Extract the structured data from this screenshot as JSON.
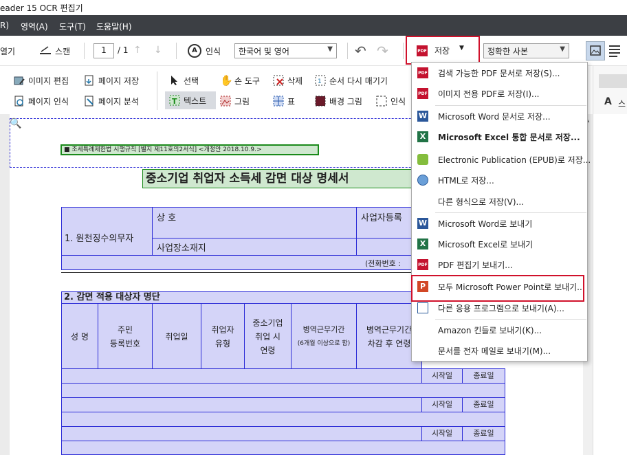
{
  "window": {
    "title": "eader 15 OCR 편집기"
  },
  "menu": {
    "items": [
      "R)",
      "영역(A)",
      "도구(T)",
      "도움말(H)"
    ]
  },
  "toolbar": {
    "open_label": "열기",
    "scan_label": "스캔",
    "page_current": "1",
    "page_total": "/ 1",
    "recognize_label": "인식",
    "language": "한국어 및 영어",
    "save_label": "저장",
    "copy_mode": "정확한 사본"
  },
  "toolbar2": {
    "image_edit": "이미지 편집",
    "page_save": "페이지 저장",
    "page_recognize": "페이지 인식",
    "page_analyze": "페이지 분석",
    "select": "선택",
    "hand_tool": "손 도구",
    "delete": "삭제",
    "reorder": "순서 다시 매기기",
    "text": "텍스트",
    "picture": "그림",
    "table": "표",
    "background": "배경 그림",
    "recognize": "인식",
    "right_partial": "스"
  },
  "save_menu": {
    "items": [
      {
        "label": "검색 가능한 PDF 문서로 저장(S)...",
        "icon": "pdf-icon"
      },
      {
        "label": "이미지 전용 PDF로 저장(I)...",
        "icon": "pdf-icon"
      },
      {
        "label": "Microsoft Word 문서로 저장...",
        "icon": "word-icon"
      },
      {
        "label": "Microsoft Excel 통합 문서로 저장...",
        "icon": "excel-icon",
        "bold": true
      },
      {
        "label": "Electronic Publication (EPUB)로 저장...",
        "icon": "epub-icon"
      },
      {
        "label": "HTML로 저장...",
        "icon": "html-icon"
      },
      {
        "label": "다른 형식으로 저장(V)...",
        "icon": ""
      },
      {
        "label": "Microsoft Word로 보내기",
        "icon": "word-send-icon"
      },
      {
        "label": "Microsoft Excel로 보내기",
        "icon": "excel-send-icon"
      },
      {
        "label": "PDF 편집기 보내기...",
        "icon": "pdf-send-icon"
      },
      {
        "label": "모두 Microsoft Power Point로 보내기...",
        "icon": "powerpoint-send-icon"
      },
      {
        "label": "다른 응용 프로그램으로 보내기(A)...",
        "icon": "app-send-icon"
      },
      {
        "label": "Amazon 킨들로 보내기(K)...",
        "icon": ""
      },
      {
        "label": "문서를 전자 메일로 보내기(M)...",
        "icon": ""
      }
    ]
  },
  "document": {
    "header_note": "■ 조세특례제한법 시행규칙 [별지 제11호의2서식] <개정안 2018.10.9.>",
    "title": "중소기업 취업자 소득세 감면 대상 명세서",
    "section1": "1. 원천징수의무자",
    "trade_name": "상  호",
    "business_reg": "사업자등록",
    "address": "사업장소재지",
    "phone": "(전화번호 :",
    "section2": "2. 감면 적용 대상자 명단",
    "col_name": "성  명",
    "col_resident_1": "주민",
    "col_resident_2": "등록번호",
    "col_employ_date": "취업일",
    "col_employ_type_1": "취업자",
    "col_employ_type_2": "유형",
    "col_age_1": "중소기업",
    "col_age_2": "취업 시",
    "col_age_3": "연령",
    "col_military_1": "병역근무기간",
    "col_military_2": "(6개월 이상으로 함)",
    "col_military2_1": "병역근무기간",
    "col_military2_2": "차감 후 연령",
    "start": "시작일",
    "end": "종료일"
  },
  "colors": {
    "accent_red": "#d0112b",
    "menubar": "#3c3f44",
    "cell_fill": "#d4d4f8",
    "cell_border": "#2b2bd6"
  }
}
